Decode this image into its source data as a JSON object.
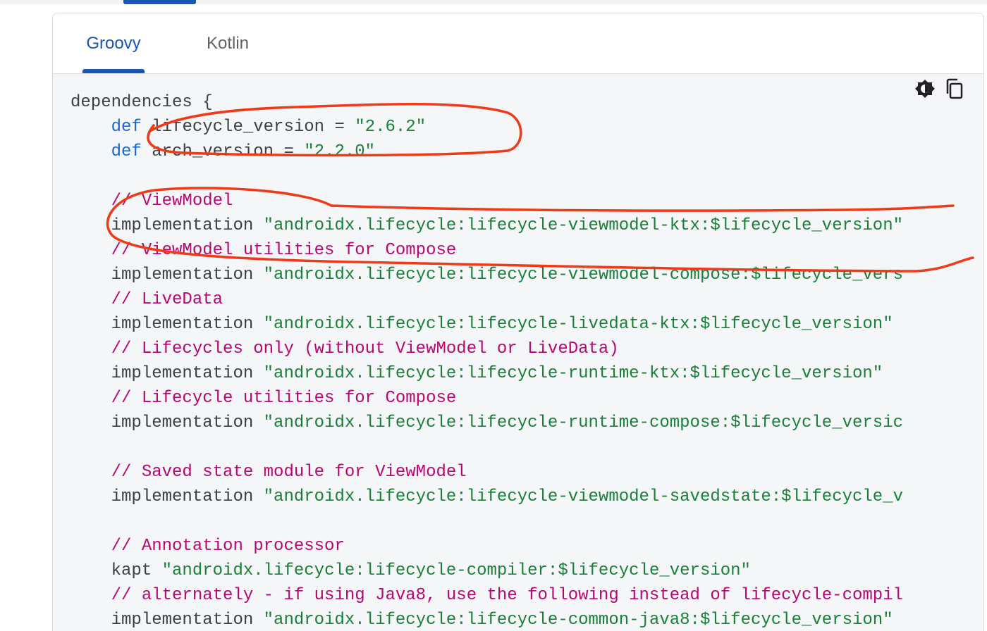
{
  "tabs": [
    {
      "label": "Groovy",
      "selected": true
    },
    {
      "label": "Kotlin",
      "selected": false
    }
  ],
  "toolbar": {
    "theme_icon": "dark-light-theme-icon",
    "copy_icon": "copy-icon"
  },
  "code": {
    "l1": "dependencies {",
    "l2_kw": "def",
    "l2_rest": " lifecycle_version = ",
    "l2_str": "\"2.6.2\"",
    "l3_kw": "def",
    "l3_rest": " arch_version = ",
    "l3_str": "\"2.2.0\"",
    "l5": "// ViewModel",
    "l6_plain": "implementation ",
    "l6_str": "\"androidx.lifecycle:lifecycle-viewmodel-ktx:$lifecycle_version\"",
    "l7": "// ViewModel utilities for Compose",
    "l8_plain": "implementation ",
    "l8_str": "\"androidx.lifecycle:lifecycle-viewmodel-compose:$lifecycle_vers",
    "l9": "// LiveData",
    "l10_plain": "implementation ",
    "l10_str": "\"androidx.lifecycle:lifecycle-livedata-ktx:$lifecycle_version\"",
    "l11": "// Lifecycles only (without ViewModel or LiveData)",
    "l12_plain": "implementation ",
    "l12_str": "\"androidx.lifecycle:lifecycle-runtime-ktx:$lifecycle_version\"",
    "l13": "// Lifecycle utilities for Compose",
    "l14_plain": "implementation ",
    "l14_str": "\"androidx.lifecycle:lifecycle-runtime-compose:$lifecycle_versic",
    "l16": "// Saved state module for ViewModel",
    "l17_plain": "implementation ",
    "l17_str": "\"androidx.lifecycle:lifecycle-viewmodel-savedstate:$lifecycle_v",
    "l19": "// Annotation processor",
    "l20_plain": "kapt ",
    "l20_str": "\"androidx.lifecycle:lifecycle-compiler:$lifecycle_version\"",
    "l21": "// alternately - if using Java8, use the following instead of lifecycle-compil",
    "l22_plain": "implementation ",
    "l22_str": "\"androidx.lifecycle:lifecycle-common-java8:$lifecycle_version\""
  },
  "colors": {
    "accent": "#1a55b5",
    "keyword": "#1a67d2",
    "string": "#188038",
    "comment": "#b80672",
    "annotation": "#f03a17"
  }
}
